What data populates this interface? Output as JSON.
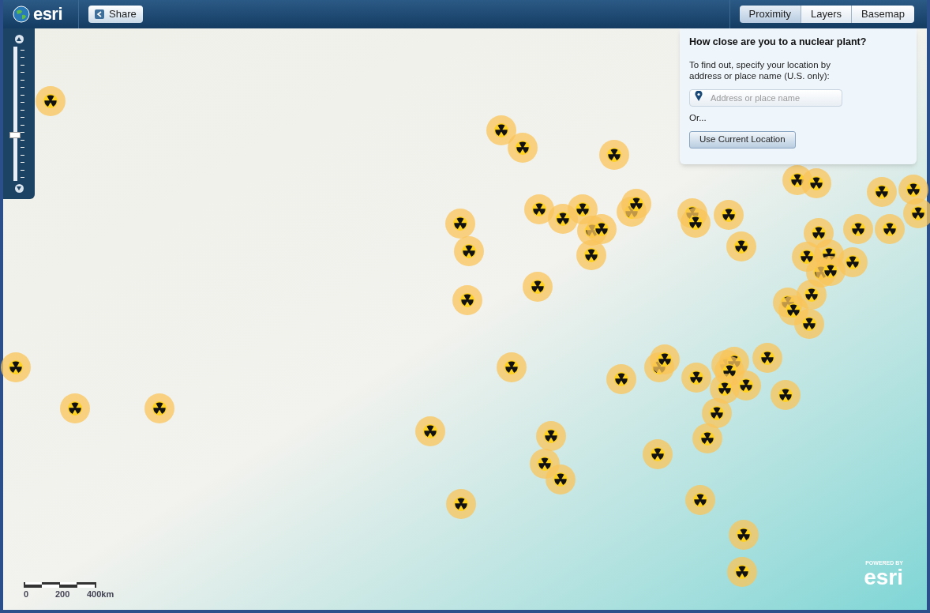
{
  "header": {
    "logo": "esri",
    "share_button": "Share",
    "tabs": [
      {
        "label": "Proximity",
        "selected": true
      },
      {
        "label": "Layers",
        "selected": false
      },
      {
        "label": "Basemap",
        "selected": false
      }
    ]
  },
  "zoom_slider": {
    "level": 0.34
  },
  "proximity_panel": {
    "title": "How close are you to a nuclear plant?",
    "instructions": "To find out, specify your location by address or place name (U.S. only):",
    "search": {
      "placeholder": "Address or place name"
    },
    "or_label": "Or...",
    "current_location_button": "Use Current Location"
  },
  "scale_bar": {
    "labels": [
      "0",
      "200",
      "400km"
    ]
  },
  "attribution": {
    "powered_by": "POWERED BY",
    "logo": "esri"
  }
}
